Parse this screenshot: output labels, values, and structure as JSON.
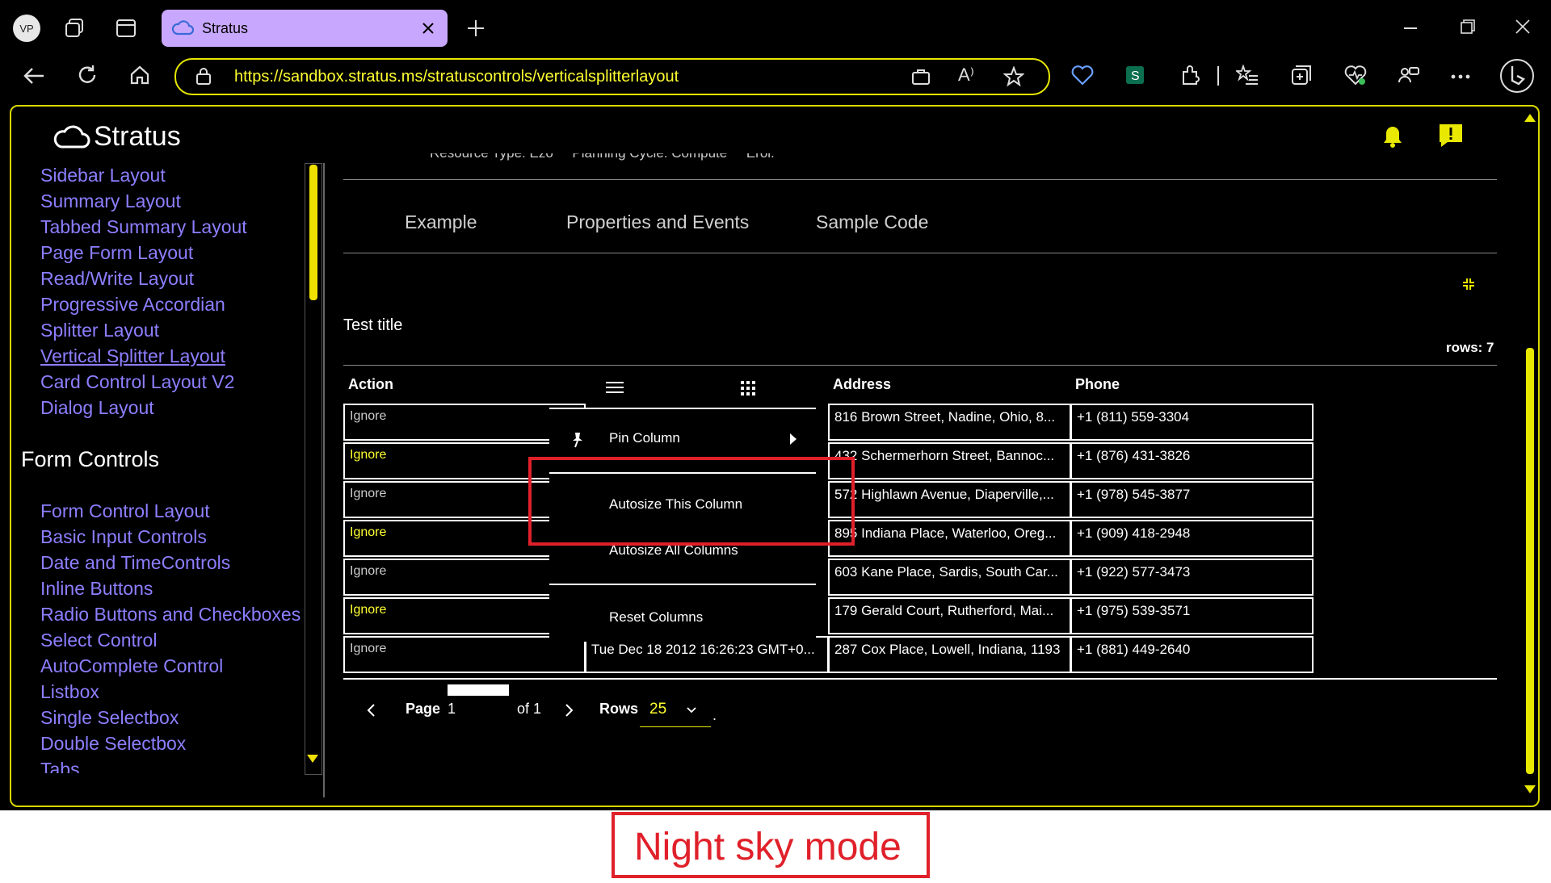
{
  "browser": {
    "avatar_initials": "VP",
    "tab_title": "Stratus",
    "url": "https://sandbox.stratus.ms/stratuscontrols/verticalsplitterlayout"
  },
  "app": {
    "logo_text": "Stratus"
  },
  "sidebar": {
    "items_top": [
      "Sidebar Layout",
      "Summary Layout",
      "Tabbed Summary Layout",
      "Page Form Layout",
      "Read/Write Layout",
      "Progressive Accordian",
      "Splitter Layout",
      "Vertical Splitter Layout",
      "Card Control Layout V2",
      "Dialog Layout"
    ],
    "section_title": "Form Controls",
    "items_bottom": [
      "Form Control Layout",
      "Basic Input Controls",
      "Date and TimeControls",
      "Inline Buttons",
      "Radio Buttons and Checkboxes",
      "Select Control",
      "AutoComplete Control",
      "Listbox",
      "Single Selectbox",
      "Double Selectbox",
      "Tabs"
    ]
  },
  "main": {
    "truncated_header": "Resource Type: Ezo     Planning Cycle: Compute     Erol.",
    "tabs": [
      "Example",
      "Properties and Events",
      "Sample Code"
    ],
    "grid_title": "Test title",
    "rows_count": "rows: 7",
    "columns": [
      "Action",
      "Address",
      "Phone"
    ],
    "rows": [
      {
        "action": "Ignore",
        "address": "816 Brown Street, Nadine, Ohio, 8...",
        "phone": "+1 (811) 559-3304"
      },
      {
        "action": "Ignore",
        "address": "432 Schermerhorn Street, Bannoc...",
        "phone": "+1 (876) 431-3826"
      },
      {
        "action": "Ignore",
        "address": "572 Highlawn Avenue, Diaperville,...",
        "phone": "+1 (978) 545-3877"
      },
      {
        "action": "Ignore",
        "address": "895 Indiana Place, Waterloo, Oreg...",
        "phone": "+1 (909) 418-2948"
      },
      {
        "action": "Ignore",
        "address": "603 Kane Place, Sardis, South Car...",
        "phone": "+1 (922) 577-3473"
      },
      {
        "action": "Ignore",
        "address": "179 Gerald Court, Rutherford, Mai...",
        "phone": "+1 (975) 539-3571"
      },
      {
        "action": "Ignore",
        "address": "287 Cox Place, Lowell, Indiana, 1193",
        "phone": "+1 (881) 449-2640"
      }
    ],
    "last_row_date": "Tue Dec 18 2012 16:26:23 GMT+0...",
    "context_menu": [
      "Pin Column",
      "Autosize This Column",
      "Autosize All Columns",
      "Reset Columns"
    ],
    "pagination": {
      "page_label": "Page",
      "page_value": "1",
      "of_label": "of 1",
      "rows_label": "Rows",
      "rows_value": "25"
    }
  },
  "caption": "Night sky mode",
  "colors": {
    "accent": "#e8e800",
    "link": "#8c7fff",
    "highlight": "#e0202a",
    "tab_bg": "#c8a8ff"
  }
}
